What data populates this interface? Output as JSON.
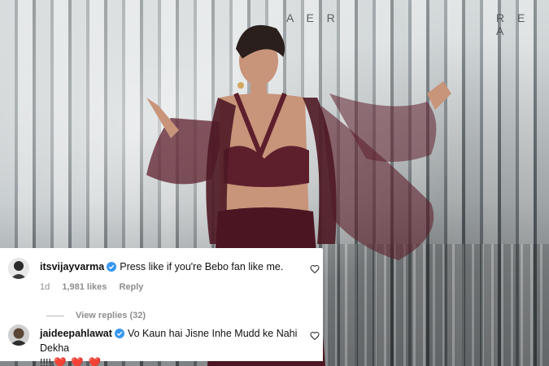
{
  "store_sign": {
    "left": "A E R",
    "right": "R E A"
  },
  "comments": [
    {
      "username": "itsvijayvarma",
      "verified": true,
      "text": "Press like if you're Bebo fan like me.",
      "time": "1d",
      "likes": "1,981 likes",
      "reply_label": "Reply",
      "view_replies": "View replies (32)",
      "avatar_icon": "profile-photo"
    },
    {
      "username": "jaideepahlawat",
      "verified": true,
      "text": "Vo Kaun hai Jisne Inhe Mudd ke Nahi Dekha",
      "text_line2": "!!!! ",
      "emoji": "❤️ ❤️ ❤️",
      "avatar_icon": "profile-photo"
    }
  ],
  "colors": {
    "outfit": "#5e1f2c",
    "verified": "#3897f0",
    "muted_text": "#8e8e8e"
  },
  "icons": {
    "verified": "verified-badge-icon",
    "like": "heart-outline-icon"
  }
}
